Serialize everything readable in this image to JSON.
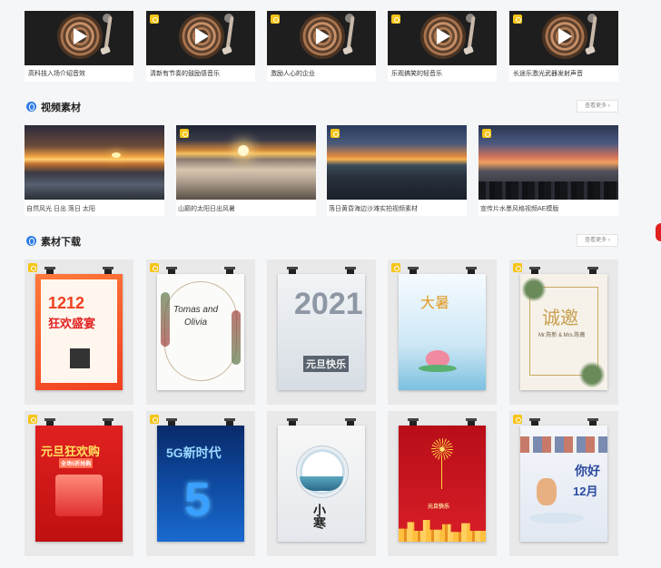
{
  "music": {
    "items": [
      {
        "title": "高科技入场介绍音效",
        "vip": false
      },
      {
        "title": "清新有节奏的鼓励感音乐",
        "vip": true
      },
      {
        "title": "激励人心的企业",
        "vip": true
      },
      {
        "title": "乐观搞笑的轻音乐",
        "vip": true
      },
      {
        "title": "长途乐激光武器发射声音",
        "vip": true
      }
    ]
  },
  "video_section": {
    "title": "视频素材",
    "more_label": "查看更多 ›",
    "items": [
      {
        "title": "自然风光 日出 落日 太阳",
        "vip": false
      },
      {
        "title": "山巅的太阳日出风暑",
        "vip": true
      },
      {
        "title": "落日黄昏海边沙滩实拍视频素材",
        "vip": true
      },
      {
        "title": "宣传片水墨风格视频AE模版",
        "vip": true
      }
    ]
  },
  "download_section": {
    "title": "素材下载",
    "more_label": "查看更多 ›",
    "row1": [
      {
        "text_a": "1212",
        "text_b": "狂欢盛宴"
      },
      {
        "text_a": "Tomas and",
        "text_b": "Olivia"
      },
      {
        "text_a": "2021",
        "text_b": "元旦快乐"
      },
      {
        "text_a": "大暑",
        "text_b": ""
      },
      {
        "text_a": "诚邀",
        "text_b": "Mr.陈新 & Mrs.陈薇"
      }
    ],
    "row2": [
      {
        "text_a": "元旦狂欢购",
        "text_b": "全场5折抢购"
      },
      {
        "text_a": "5G新时代",
        "text_b": "5"
      },
      {
        "text_a": "小寒",
        "text_b": ""
      },
      {
        "text_a": "",
        "text_b": "元旦快乐"
      },
      {
        "text_a": "你好",
        "text_b": "12月"
      }
    ]
  },
  "colors": {
    "accent_blue": "#2d7be5",
    "vip_badge": "#f5c518",
    "poster_red": "#e02020"
  }
}
